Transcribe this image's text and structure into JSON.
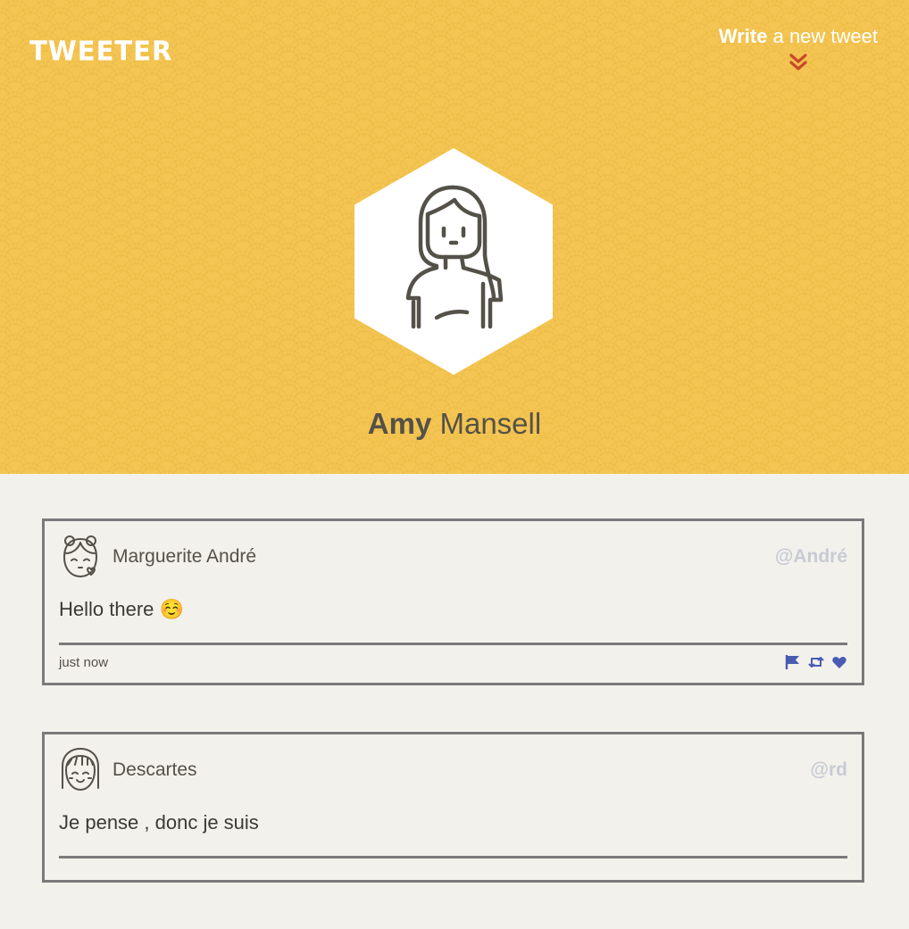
{
  "header": {
    "logo": "TWEETER",
    "compose_bold": "Write",
    "compose_rest": " a new tweet",
    "compose_icon": "double-chevron-down-icon",
    "accent_color": "#c8482a",
    "background_color": "#f4c552"
  },
  "profile": {
    "first_name": "Amy",
    "last_name": " Mansell",
    "avatar_icon": "woman-avatar-icon"
  },
  "tweets": [
    {
      "name": "Marguerite André",
      "handle": "@André",
      "text": "Hello there ☺️",
      "time": "just now",
      "avatar_icon": "girl-kiss-avatar-icon"
    },
    {
      "name": "Descartes",
      "handle": "@rd",
      "text": "Je pense , donc je suis",
      "time": "",
      "avatar_icon": "girl-smile-avatar-icon"
    }
  ],
  "actions": {
    "flag_icon": "flag-icon",
    "retweet_icon": "retweet-icon",
    "like_icon": "heart-icon",
    "color": "#4a5bb2"
  }
}
